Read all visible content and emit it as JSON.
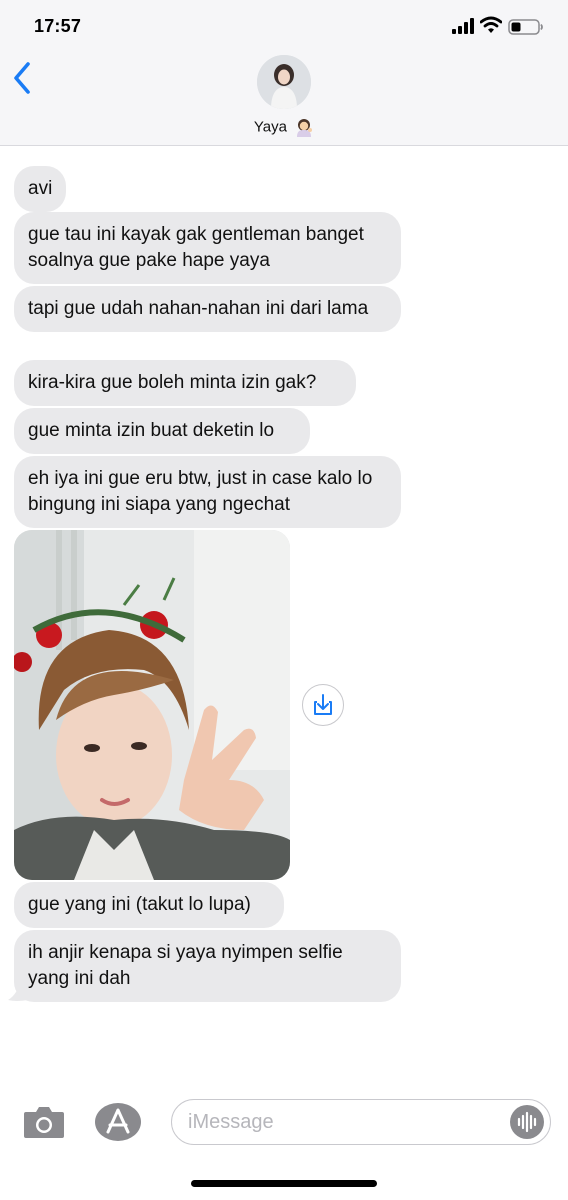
{
  "status": {
    "time": "17:57"
  },
  "header": {
    "contact_name": "Yaya",
    "contact_emoji": "woman-tipping-hand-emoji"
  },
  "messages": [
    {
      "text": "avi"
    },
    {
      "text": "gue tau ini kayak gak gentleman banget soalnya gue pake hape yaya"
    },
    {
      "text": "tapi gue udah nahan-nahan ini dari lama"
    },
    {
      "text": "kira-kira gue boleh minta izin gak?"
    },
    {
      "text": "gue minta izin buat deketin lo"
    },
    {
      "text": "eh iya ini gue eru btw, just in case kalo lo bingung ini siapa yang ngechat"
    },
    {
      "text": "gue yang ini (takut lo lupa)"
    },
    {
      "text": "ih anjir kenapa si yaya nyimpen selfie yang ini dah"
    }
  ],
  "input": {
    "placeholder": "iMessage"
  },
  "colors": {
    "accent": "#1a7cf5",
    "bubble": "#e9e9eb",
    "header_bg": "#f6f6f8"
  },
  "icons": [
    "back-chevron-icon",
    "camera-icon",
    "app-store-icon",
    "audio-waveform-icon",
    "save-download-icon"
  ]
}
